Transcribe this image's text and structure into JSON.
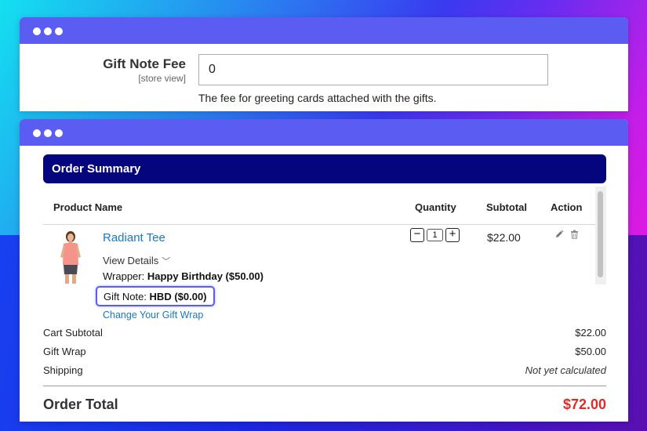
{
  "settings": {
    "field_label": "Gift Note Fee",
    "scope": "[store view]",
    "value": "0",
    "note": "The fee for greeting cards attached with the gifts."
  },
  "summary": {
    "title": "Order Summary",
    "columns": [
      "Product Name",
      "Quantity",
      "Subtotal",
      "Action"
    ],
    "item": {
      "name": "Radiant Tee",
      "view_details": "View Details",
      "wrapper_label": "Wrapper:",
      "wrapper_value": "Happy Birthday ($50.00)",
      "gift_note_label": "Gift Note:",
      "gift_note_value": "HBD ($0.00)",
      "change_link": "Change Your Gift Wrap",
      "qty_minus": "−",
      "qty": "1",
      "qty_plus": "+",
      "subtotal": "$22.00",
      "icons": [
        "pencil-icon",
        "trash-icon"
      ]
    },
    "totals": [
      {
        "label": "Cart Subtotal",
        "value": "$22.00"
      },
      {
        "label": "Gift Wrap",
        "value": "$50.00"
      },
      {
        "label": "Shipping",
        "value": "Not yet calculated"
      }
    ],
    "grand_total": {
      "label": "Order Total",
      "value": "$72.00"
    }
  },
  "colors": {
    "titlebar": "#5a5cf2",
    "summary_bar": "#05057e",
    "link": "#1979c3",
    "grand_total": "#e02b27"
  }
}
